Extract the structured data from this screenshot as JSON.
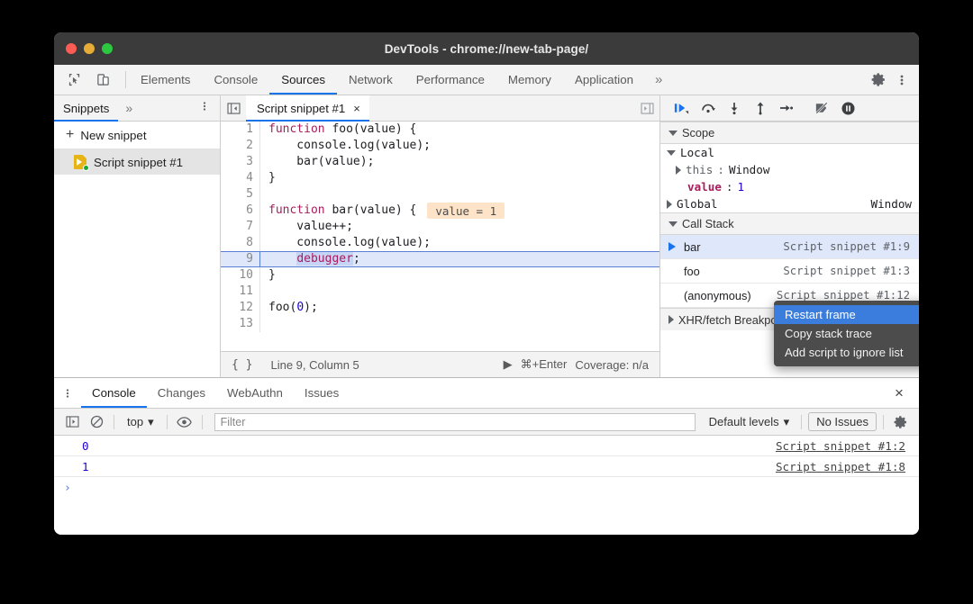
{
  "window": {
    "title": "DevTools - chrome://new-tab-page/",
    "traffic_lights": [
      "close",
      "minimize",
      "maximize"
    ]
  },
  "main_tabs": {
    "left_icons": [
      "inspect-element-icon",
      "device-toolbar-icon"
    ],
    "items": [
      {
        "label": "Elements",
        "selected": false
      },
      {
        "label": "Console",
        "selected": false
      },
      {
        "label": "Sources",
        "selected": true
      },
      {
        "label": "Network",
        "selected": false
      },
      {
        "label": "Performance",
        "selected": false
      },
      {
        "label": "Memory",
        "selected": false
      },
      {
        "label": "Application",
        "selected": false
      }
    ],
    "overflow": "»",
    "right_icons": [
      "settings-gear-icon",
      "more-options-icon"
    ]
  },
  "navigator": {
    "tab_label": "Snippets",
    "overflow": "»",
    "more_label": "⋮",
    "new_snippet_label": "New snippet",
    "new_snippet_plus": "+",
    "items": [
      {
        "label": "Script snippet #1",
        "selected": true
      }
    ]
  },
  "editor": {
    "tab_label": "Script snippet #1",
    "tab_close": "×",
    "show_navigator_icon": "show-navigator-icon",
    "show_debugger_icon": "show-debugger-icon",
    "lines": [
      {
        "n": "1",
        "tokens": [
          {
            "t": "function",
            "c": "kw"
          },
          {
            "t": " foo(value) {",
            "c": ""
          }
        ]
      },
      {
        "n": "2",
        "tokens": [
          {
            "t": "    console.log(value);",
            "c": ""
          }
        ]
      },
      {
        "n": "3",
        "tokens": [
          {
            "t": "    bar(value);",
            "c": ""
          }
        ]
      },
      {
        "n": "4",
        "tokens": [
          {
            "t": "}",
            "c": ""
          }
        ]
      },
      {
        "n": "5",
        "tokens": [
          {
            "t": "",
            "c": ""
          }
        ]
      },
      {
        "n": "6",
        "tokens": [
          {
            "t": "function",
            "c": "kw"
          },
          {
            "t": " bar(value) {",
            "c": ""
          }
        ],
        "hint": "value = 1"
      },
      {
        "n": "7",
        "tokens": [
          {
            "t": "    value++;",
            "c": ""
          }
        ]
      },
      {
        "n": "8",
        "tokens": [
          {
            "t": "    console.log(value);",
            "c": ""
          }
        ]
      },
      {
        "n": "9",
        "tokens": [
          {
            "t": "    ",
            "c": ""
          },
          {
            "t": "debugger",
            "c": "dbg"
          },
          {
            "t": ";",
            "c": ""
          }
        ],
        "active": true
      },
      {
        "n": "10",
        "tokens": [
          {
            "t": "}",
            "c": ""
          }
        ]
      },
      {
        "n": "11",
        "tokens": [
          {
            "t": "",
            "c": ""
          }
        ]
      },
      {
        "n": "12",
        "tokens": [
          {
            "t": "foo(",
            "c": ""
          },
          {
            "t": "0",
            "c": "num"
          },
          {
            "t": ");",
            "c": ""
          }
        ]
      },
      {
        "n": "13",
        "tokens": [
          {
            "t": "",
            "c": ""
          }
        ]
      }
    ],
    "status": {
      "braces": "{ }",
      "position": "Line 9, Column 5",
      "run_icon": "▶",
      "run_shortcut": "⌘+Enter",
      "coverage": "Coverage: n/a"
    }
  },
  "debugger": {
    "toolbar": [
      {
        "name": "resume-script-execution-icon"
      },
      {
        "name": "step-over-next-function-call-icon"
      },
      {
        "name": "step-into-next-function-call-icon"
      },
      {
        "name": "step-out-of-current-function-icon"
      },
      {
        "name": "step-icon"
      },
      {
        "name": "deactivate-breakpoints-icon"
      },
      {
        "name": "pause-on-exceptions-icon"
      }
    ],
    "scope": {
      "title": "Scope",
      "groups": [
        {
          "name": "Local",
          "expanded": true,
          "rows": [
            {
              "key": "this",
              "sep": ":",
              "value": "Window",
              "expandable": true,
              "key_style": "gray"
            },
            {
              "key": "value",
              "sep": ":",
              "value": "1",
              "expandable": false,
              "key_style": "prop"
            }
          ]
        },
        {
          "name": "Global",
          "expanded": false,
          "right": "Window"
        }
      ]
    },
    "call_stack": {
      "title": "Call Stack",
      "frames": [
        {
          "name": "bar",
          "location": "Script snippet #1:9",
          "selected": true
        },
        {
          "name": "foo",
          "location": "Script snippet #1:3",
          "selected": false
        },
        {
          "name": "(anonymous)",
          "location": "Script snippet #1:12",
          "selected": false
        }
      ]
    },
    "xhr_breakpoints": {
      "title": "XHR/fetch Breakpoints"
    }
  },
  "context_menu": {
    "items": [
      {
        "label": "Restart frame",
        "highlighted": true
      },
      {
        "label": "Copy stack trace",
        "highlighted": false
      },
      {
        "label": "Add script to ignore list",
        "highlighted": false
      }
    ]
  },
  "drawer": {
    "more_label": "⋮",
    "tabs": [
      {
        "label": "Console",
        "selected": true
      },
      {
        "label": "Changes",
        "selected": false
      },
      {
        "label": "WebAuthn",
        "selected": false
      },
      {
        "label": "Issues",
        "selected": false
      }
    ],
    "close_label": "×",
    "toolbar": {
      "sidebar_icon": "console-sidebar-icon",
      "clear_icon": "clear-console-icon",
      "context_selector": "top",
      "context_caret": "▾",
      "eye_icon": "create-live-expression-icon",
      "filter_placeholder": "Filter",
      "levels_label": "Default levels",
      "levels_caret": "▾",
      "issues_label": "No Issues",
      "settings_icon": "console-settings-gear-icon"
    },
    "messages": [
      {
        "value": "0",
        "source": "Script snippet #1:2"
      },
      {
        "value": "1",
        "source": "Script snippet #1:8"
      }
    ],
    "prompt": "›"
  },
  "colors": {
    "accent": "#1a73e8",
    "titlebar": "#3b3b3b",
    "toolbar_bg": "#f3f3f3",
    "selected_row": "#dfe7fb",
    "hint_bg": "#fde3c8",
    "menu_bg": "#4c4c4c",
    "menu_highlight": "#3b7ddd",
    "keyword": "#a71d5d",
    "number": "#1c00cf"
  }
}
